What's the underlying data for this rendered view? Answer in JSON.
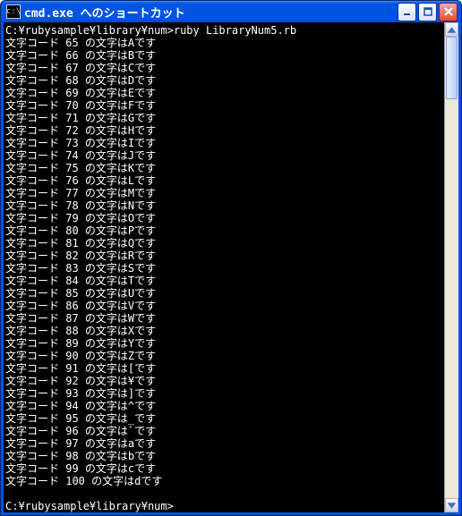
{
  "window": {
    "icon_text": "c:\\",
    "title": "cmd.exe へのショートカット"
  },
  "buttons": {
    "minimize": "minimize-button",
    "maximize": "maximize-button",
    "close": "close-button"
  },
  "terminal": {
    "prompt1": "C:¥rubysample¥library¥num>",
    "command": "ruby LibraryNum5.rb",
    "line_prefix": "文字コード ",
    "line_mid": " の文字は",
    "line_suffix": "です",
    "output": [
      {
        "code": "65",
        "ch": "A"
      },
      {
        "code": "66",
        "ch": "B"
      },
      {
        "code": "67",
        "ch": "C"
      },
      {
        "code": "68",
        "ch": "D"
      },
      {
        "code": "69",
        "ch": "E"
      },
      {
        "code": "70",
        "ch": "F"
      },
      {
        "code": "71",
        "ch": "G"
      },
      {
        "code": "72",
        "ch": "H"
      },
      {
        "code": "73",
        "ch": "I"
      },
      {
        "code": "74",
        "ch": "J"
      },
      {
        "code": "75",
        "ch": "K"
      },
      {
        "code": "76",
        "ch": "L"
      },
      {
        "code": "77",
        "ch": "M"
      },
      {
        "code": "78",
        "ch": "N"
      },
      {
        "code": "79",
        "ch": "O"
      },
      {
        "code": "80",
        "ch": "P"
      },
      {
        "code": "81",
        "ch": "Q"
      },
      {
        "code": "82",
        "ch": "R"
      },
      {
        "code": "83",
        "ch": "S"
      },
      {
        "code": "84",
        "ch": "T"
      },
      {
        "code": "85",
        "ch": "U"
      },
      {
        "code": "86",
        "ch": "V"
      },
      {
        "code": "87",
        "ch": "W"
      },
      {
        "code": "88",
        "ch": "X"
      },
      {
        "code": "89",
        "ch": "Y"
      },
      {
        "code": "90",
        "ch": "Z"
      },
      {
        "code": "91",
        "ch": "["
      },
      {
        "code": "92",
        "ch": "¥"
      },
      {
        "code": "93",
        "ch": "]"
      },
      {
        "code": "94",
        "ch": "^"
      },
      {
        "code": "95",
        "ch": "_"
      },
      {
        "code": "96",
        "ch": "`"
      },
      {
        "code": "97",
        "ch": "a"
      },
      {
        "code": "98",
        "ch": "b"
      },
      {
        "code": "99",
        "ch": "c"
      },
      {
        "code": "100",
        "ch": "d"
      }
    ],
    "prompt2": "C:¥rubysample¥library¥num>"
  }
}
